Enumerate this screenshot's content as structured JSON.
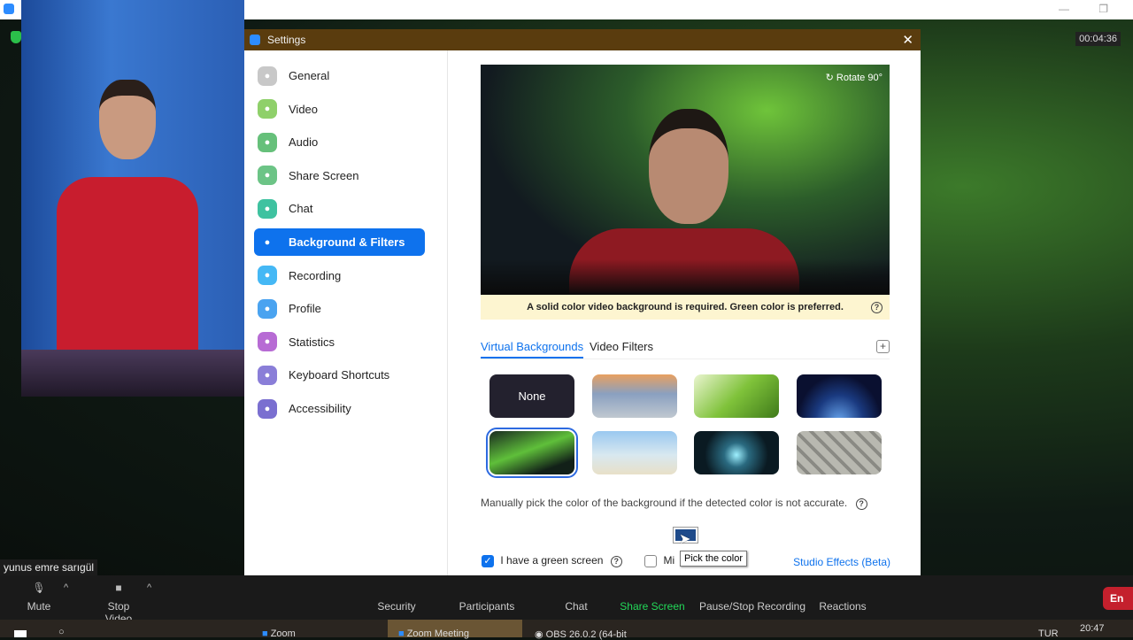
{
  "meeting": {
    "timer": "00:04:36",
    "participant_name": "yunus emre sarıgül"
  },
  "dialog": {
    "title": "Settings",
    "close_icon": "close-icon"
  },
  "sidebar": {
    "items": [
      {
        "label": "General",
        "icon": "gear-icon",
        "color": "#c8c8c8"
      },
      {
        "label": "Video",
        "icon": "video-icon",
        "color": "#8fd06a"
      },
      {
        "label": "Audio",
        "icon": "headphones-icon",
        "color": "#66c07a"
      },
      {
        "label": "Share Screen",
        "icon": "share-screen-icon",
        "color": "#6cc486"
      },
      {
        "label": "Chat",
        "icon": "chat-icon",
        "color": "#3fc2a0"
      },
      {
        "label": "Background & Filters",
        "icon": "background-icon",
        "color": "#0e72ed",
        "active": true
      },
      {
        "label": "Recording",
        "icon": "recording-icon",
        "color": "#45b8f5"
      },
      {
        "label": "Profile",
        "icon": "profile-icon",
        "color": "#4aa3f0"
      },
      {
        "label": "Statistics",
        "icon": "statistics-icon",
        "color": "#b76bd4"
      },
      {
        "label": "Keyboard Shortcuts",
        "icon": "keyboard-icon",
        "color": "#8a7ed8"
      },
      {
        "label": "Accessibility",
        "icon": "accessibility-icon",
        "color": "#7a6fd0"
      }
    ]
  },
  "main": {
    "rotate_label": "Rotate 90°",
    "notice": "A solid color video background is required. Green color is preferred.",
    "tabs": [
      {
        "label": "Virtual Backgrounds",
        "active": true
      },
      {
        "label": "Video Filters"
      }
    ],
    "backgrounds": [
      {
        "label": "None"
      },
      {
        "name": "golden-gate"
      },
      {
        "name": "grass"
      },
      {
        "name": "earth-from-space"
      },
      {
        "name": "aurora",
        "selected": true
      },
      {
        "name": "beach-palm"
      },
      {
        "name": "sci-fi-corridor"
      },
      {
        "name": "castle-pattern"
      }
    ],
    "manual_pick_text": "Manually pick the color of the background if the detected color is not accurate.",
    "picked_color": "#1e4a8a",
    "tooltip": "Pick the color",
    "green_screen_label": "I have a green screen",
    "green_screen_checked": true,
    "mirror_label_partial": "Mi",
    "mirror_checked": false,
    "studio_effects": "Studio Effects (Beta)"
  },
  "toolbar": {
    "items": [
      "Mute",
      "Stop Video",
      "Security",
      "Participants",
      "Chat",
      "Share Screen",
      "Pause/Stop Recording",
      "Reactions"
    ],
    "end": "En",
    "share_color": "#23d959"
  },
  "taskbar": {
    "items": [
      "Zoom",
      "Zoom Meeting",
      "OBS 26.0.2 (64-bit"
    ],
    "lang": "TUR",
    "time": "20:47"
  }
}
